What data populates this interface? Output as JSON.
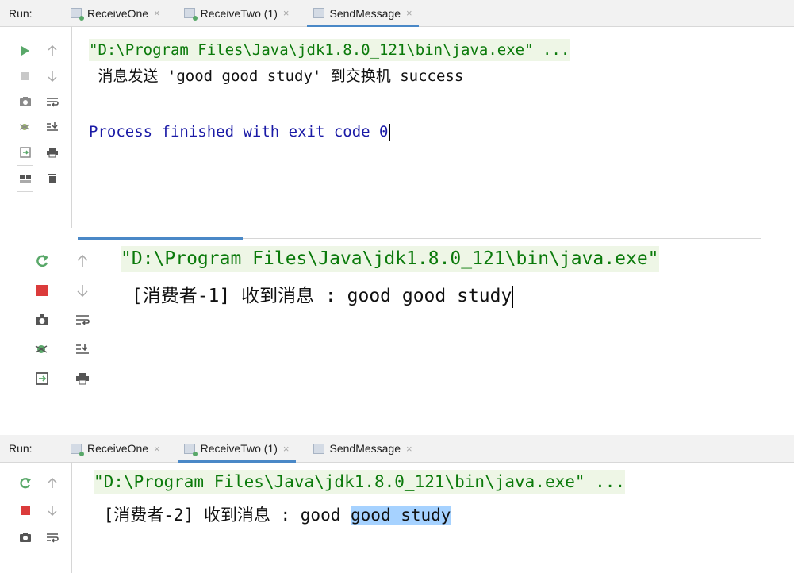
{
  "top": {
    "run_label": "Run:",
    "tabs": [
      {
        "label": "ReceiveOne",
        "close": "×"
      },
      {
        "label": "ReceiveTwo (1)",
        "close": "×"
      },
      {
        "label": "SendMessage",
        "close": "×"
      }
    ],
    "active_tab": 2,
    "lines": {
      "cmd": "\"D:\\Program Files\\Java\\jdk1.8.0_121\\bin\\java.exe\" ...",
      "out": " 消息发送 'good good study' 到交换机 success",
      "exit": "Process finished with exit code 0"
    },
    "icons": [
      "run-icon",
      "up-arrow-icon",
      "stop-icon",
      "down-arrow-icon",
      "camera-icon",
      "soft-wrap-icon",
      "debug-icon",
      "scroll-to-end-icon",
      "restore-layout-icon",
      "print-icon",
      "layout-icon",
      "trash-icon"
    ]
  },
  "middle": {
    "lines": {
      "cmd": "\"D:\\Program Files\\Java\\jdk1.8.0_121\\bin\\java.exe\"",
      "out": " [消费者-1] 收到消息 : good good study"
    },
    "icons": [
      "rerun-icon",
      "up-arrow-icon",
      "stop-icon",
      "down-arrow-icon",
      "camera-icon",
      "soft-wrap-icon",
      "debug-icon",
      "scroll-to-end-icon",
      "restore-layout-icon",
      "print-icon"
    ]
  },
  "bottom": {
    "run_label": "Run:",
    "tabs": [
      {
        "label": "ReceiveOne",
        "close": "×"
      },
      {
        "label": "ReceiveTwo (1)",
        "close": "×"
      },
      {
        "label": "SendMessage",
        "close": "×"
      }
    ],
    "active_tab": 1,
    "lines": {
      "cmd": "\"D:\\Program Files\\Java\\jdk1.8.0_121\\bin\\java.exe\" ...",
      "out_plain": " [消费者-2] 收到消息 : good ",
      "out_selected": "good study"
    },
    "icons": [
      "rerun-icon",
      "up-arrow-icon",
      "stop-icon",
      "down-arrow-icon",
      "camera-icon",
      "soft-wrap-icon"
    ]
  },
  "colors": {
    "command": "#0b7a0b",
    "command_bg": "#eef6e6",
    "exit_message": "#1a1aa6",
    "run_green": "#59a869",
    "stop_red": "#db3b3b",
    "active_tab_underline": "#4a88c7",
    "selection": "#a6d2ff"
  }
}
